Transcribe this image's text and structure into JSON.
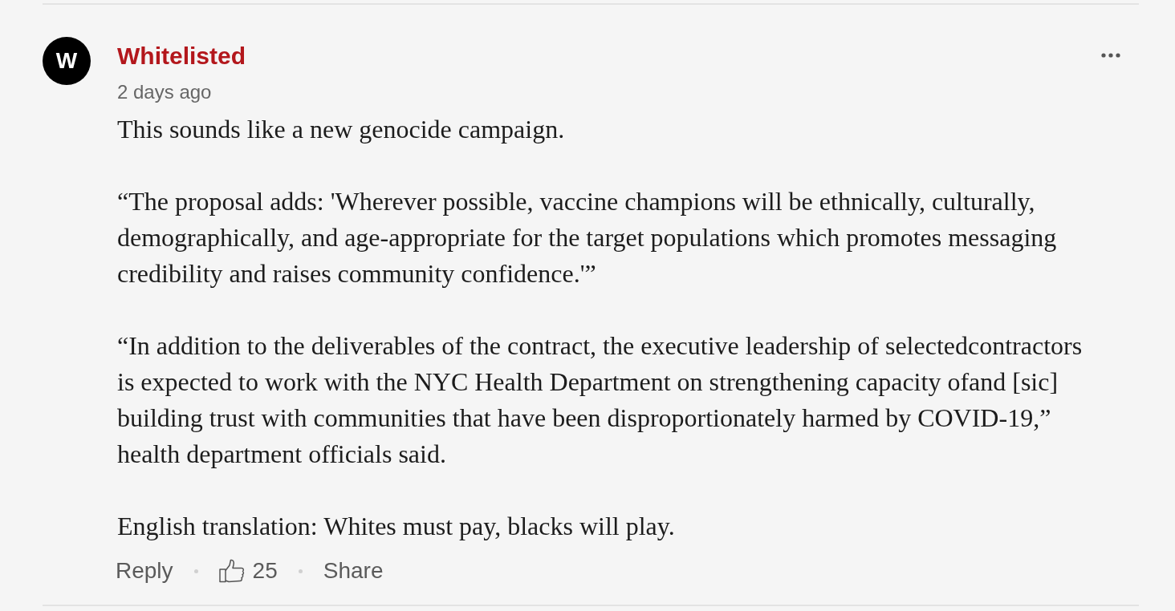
{
  "comment": {
    "avatar": {
      "initial": "W"
    },
    "author": "Whitelisted",
    "time": "2 days ago",
    "paragraphs": [
      "This sounds like a new genocide campaign.",
      "“The proposal adds: 'Wherever possible, vaccine champions will be ethnically, culturally, demographically, and age-appropriate for the target populations which promotes messaging credibility and raises community confidence.'”",
      "“In addition to the deliverables of the contract, the executive leadership of selectedcontractors is expected to work with the NYC Health Department on strengthening capacity ofand [sic] building trust with communities that have been disproportionately harmed by COVID-19,” health department officials said.",
      "English translation: Whites must pay, blacks will play."
    ],
    "actions": {
      "reply": "Reply",
      "likes": "25",
      "share": "Share"
    }
  }
}
